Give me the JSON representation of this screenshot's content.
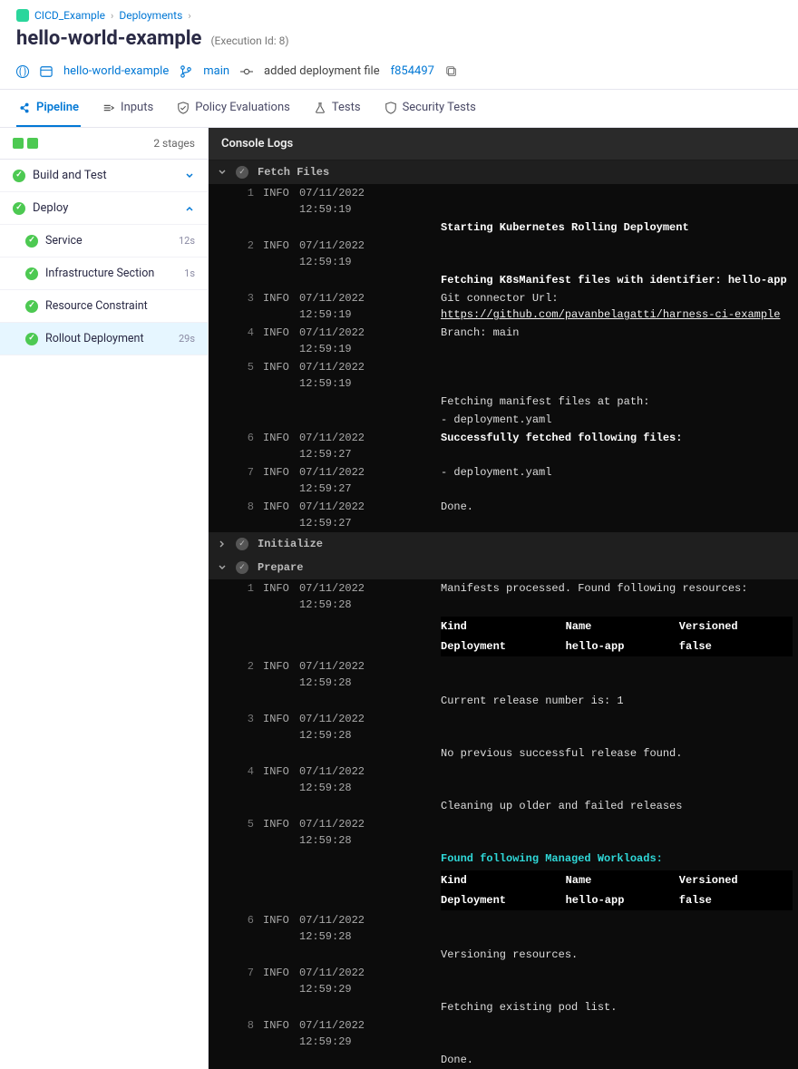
{
  "breadcrumb": {
    "project": "CICD_Example",
    "section": "Deployments"
  },
  "title": "hello-world-example",
  "execution_id": "(Execution Id: 8)",
  "metabar": {
    "pipeline": "hello-world-example",
    "branch": "main",
    "commit_msg": "added deployment file",
    "commit_hash": "f854497"
  },
  "tabs": [
    {
      "label": "Pipeline",
      "active": true
    },
    {
      "label": "Inputs",
      "active": false
    },
    {
      "label": "Policy Evaluations",
      "active": false
    },
    {
      "label": "Tests",
      "active": false
    },
    {
      "label": "Security Tests",
      "active": false
    }
  ],
  "stage_summary": "2 stages",
  "stages": [
    {
      "name": "Build and Test",
      "expanded": false
    },
    {
      "name": "Deploy",
      "expanded": true,
      "steps": [
        {
          "name": "Service",
          "time": "12s"
        },
        {
          "name": "Infrastructure Section",
          "time": "1s"
        },
        {
          "name": "Resource Constraint",
          "time": ""
        },
        {
          "name": "Rollout Deployment",
          "time": "29s",
          "selected": true
        }
      ]
    }
  ],
  "console_title": "Console Logs",
  "sections": {
    "fetch": "Fetch Files",
    "init": "Initialize",
    "prepare": "Prepare"
  },
  "fetch_lines": [
    {
      "n": "1",
      "lvl": "INFO",
      "ts": "07/11/2022 12:59:19",
      "msg": "",
      "cls": ""
    },
    {
      "n": "",
      "lvl": "",
      "ts": "",
      "msg": "Starting Kubernetes Rolling Deployment",
      "cls": "bold"
    },
    {
      "n": "2",
      "lvl": "INFO",
      "ts": "07/11/2022 12:59:19",
      "msg": "",
      "cls": ""
    },
    {
      "n": "",
      "lvl": "",
      "ts": "",
      "msg": "Fetching K8sManifest files with identifier: hello-app",
      "cls": "bold"
    },
    {
      "n": "3",
      "lvl": "INFO",
      "ts": "07/11/2022 12:59:19",
      "msg_html": "Git connector Url: <a href='#'>https://github.com/pavanbelagatti/harness-ci-example</a>"
    },
    {
      "n": "4",
      "lvl": "INFO",
      "ts": "07/11/2022 12:59:19",
      "msg": "Branch: main"
    },
    {
      "n": "5",
      "lvl": "INFO",
      "ts": "07/11/2022 12:59:19",
      "msg": ""
    },
    {
      "n": "",
      "lvl": "",
      "ts": "",
      "msg": "Fetching manifest files at path:"
    },
    {
      "n": "",
      "lvl": "",
      "ts": "",
      "msg": "- deployment.yaml"
    },
    {
      "n": "6",
      "lvl": "INFO",
      "ts": "07/11/2022 12:59:27",
      "msg": "Successfully fetched following files:",
      "cls": "bold"
    },
    {
      "n": "7",
      "lvl": "INFO",
      "ts": "07/11/2022 12:59:27",
      "msg": "- deployment.yaml"
    },
    {
      "n": "8",
      "lvl": "INFO",
      "ts": "07/11/2022 12:59:27",
      "msg": "Done."
    }
  ],
  "prepare_lines_before_tbl1": [
    {
      "n": "1",
      "lvl": "INFO",
      "ts": "07/11/2022 12:59:28",
      "msg": "Manifests processed. Found following resources:"
    }
  ],
  "table1": {
    "cols": [
      "Kind",
      "Name",
      "Versioned"
    ],
    "rows": [
      [
        "Deployment",
        "hello-app",
        "false"
      ]
    ]
  },
  "prepare_after_tbl1": [
    {
      "n": "2",
      "lvl": "INFO",
      "ts": "07/11/2022 12:59:28",
      "msg": ""
    },
    {
      "n": "",
      "lvl": "",
      "ts": "",
      "msg": "Current release number is: 1"
    },
    {
      "n": "3",
      "lvl": "INFO",
      "ts": "07/11/2022 12:59:28",
      "msg": ""
    },
    {
      "n": "",
      "lvl": "",
      "ts": "",
      "msg": "No previous successful release found."
    },
    {
      "n": "4",
      "lvl": "INFO",
      "ts": "07/11/2022 12:59:28",
      "msg": ""
    },
    {
      "n": "",
      "lvl": "",
      "ts": "",
      "msg": "Cleaning up older and failed releases"
    },
    {
      "n": "5",
      "lvl": "INFO",
      "ts": "07/11/2022 12:59:28",
      "msg": ""
    },
    {
      "n": "",
      "lvl": "",
      "ts": "",
      "msg_html": "<span class='cyan'>Found following Managed Workloads:</span>"
    }
  ],
  "table2": {
    "cols": [
      "Kind",
      "Name",
      "Versioned"
    ],
    "rows": [
      [
        "Deployment",
        "hello-app",
        "false"
      ]
    ]
  },
  "prepare_tail": [
    {
      "n": "6",
      "lvl": "INFO",
      "ts": "07/11/2022 12:59:28",
      "msg": ""
    },
    {
      "n": "",
      "lvl": "",
      "ts": "",
      "msg": "Versioning resources."
    },
    {
      "n": "7",
      "lvl": "INFO",
      "ts": "07/11/2022 12:59:29",
      "msg": ""
    },
    {
      "n": "",
      "lvl": "",
      "ts": "",
      "msg": "Fetching existing pod list."
    },
    {
      "n": "8",
      "lvl": "INFO",
      "ts": "07/11/2022 12:59:29",
      "msg": ""
    },
    {
      "n": "",
      "lvl": "",
      "ts": "",
      "msg": "Done."
    }
  ]
}
